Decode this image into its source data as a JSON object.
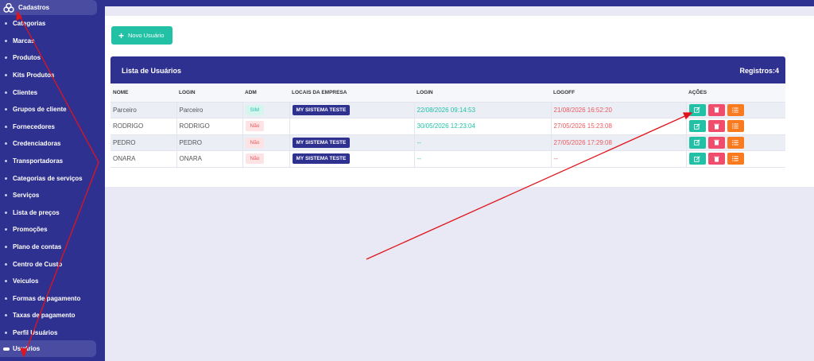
{
  "sidebar": {
    "header_label": "Cadastros",
    "items": [
      "Categorias",
      "Marcas",
      "Produtos",
      "Kits Produtos",
      "Clientes",
      "Grupos de cliente",
      "Fornecedores",
      "Credenciadoras",
      "Transportadoras",
      "Categorias de serviços",
      "Serviços",
      "Lista de preços",
      "Promoções",
      "Plano de contas",
      "Centro de Custo",
      "Veiculos",
      "Formas de pagamento",
      "Taxas de pagamento",
      "Perfil Usuários"
    ],
    "active_label": "Usuários"
  },
  "toolbar": {
    "new_user_label": "Novo Usuário"
  },
  "card": {
    "title": "Lista de Usuários",
    "count": "Registros:4"
  },
  "table": {
    "headers": [
      "NOME",
      "LOGIN",
      "ADM",
      "LOCAIS DA EMPRESA",
      "LOGIN",
      "LOGOFF",
      "AÇÕES"
    ],
    "rows": [
      {
        "nome": "Parceiro",
        "login": "Parceiro",
        "adm": "SIM",
        "local": "MY SISTEMA TESTE",
        "login_time": "22/08/2026 09:14:53",
        "logoff_time": "21/08/2026 16:52:20"
      },
      {
        "nome": "RODRIGO",
        "login": "RODRIGO",
        "adm": "Não",
        "local": "",
        "login_time": "30/05/2026 12:23:04",
        "logoff_time": "27/05/2026 15:23:08"
      },
      {
        "nome": "PEDRO",
        "login": "PEDRO",
        "adm": "Não",
        "local": "MY SISTEMA TESTE",
        "login_time": "--",
        "logoff_time": "27/05/2026 17:29:08"
      },
      {
        "nome": "ONARA",
        "login": "ONARA",
        "adm": "Não",
        "local": "MY SISTEMA TESTE",
        "login_time": "--",
        "logoff_time": "--"
      }
    ]
  },
  "colors": {
    "primary": "#2f3191",
    "accent": "#22c1a6",
    "danger": "#ef4d6b",
    "warning": "#f97a1f",
    "annotation": "#e0141b"
  },
  "icons": {
    "logo": "cubes-icon",
    "add": "plus-icon",
    "edit": "edit-icon",
    "delete": "trash-icon",
    "details": "list-icon"
  }
}
